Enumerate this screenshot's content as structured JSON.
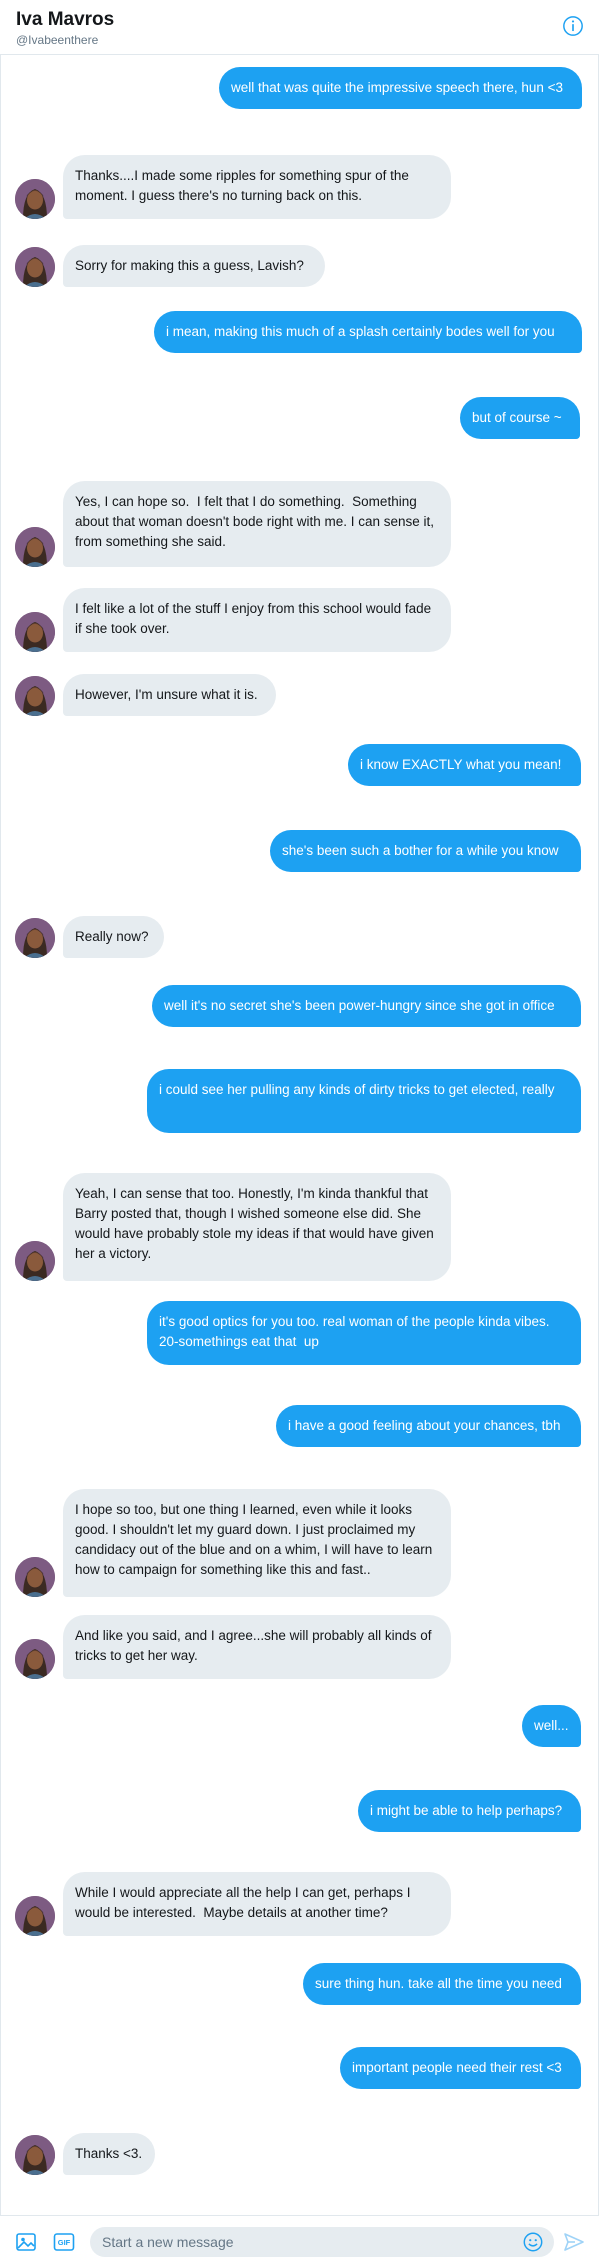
{
  "header": {
    "name": "Iva Mavros",
    "handle": "@Ivabeenthere"
  },
  "icons": {
    "info": "info-icon",
    "media": "image-icon",
    "gif": "gif-icon",
    "emoji": "emoji-icon",
    "send": "send-icon"
  },
  "colors": {
    "accent": "#1da1f2",
    "incoming_bubble": "#e6ecf0"
  },
  "gif_label": "GIF",
  "messages": [
    {
      "direction": "out",
      "text": "well that was quite the impressive speech there, hun <3"
    },
    {
      "direction": "in",
      "text": "Thanks....I made some ripples for something spur of the moment. I guess there's no turning back on this."
    },
    {
      "direction": "in",
      "text": "Sorry for making this a guess, Lavish?"
    },
    {
      "direction": "out",
      "text": "i mean, making this much of a splash certainly bodes well for you"
    },
    {
      "direction": "out",
      "text": "but of course ~"
    },
    {
      "direction": "in",
      "text": "Yes, I can hope so.  I felt that I do something.  Something about that woman doesn't bode right with me. I can sense it, from something she said."
    },
    {
      "direction": "in",
      "text": "I felt like a lot of the stuff I enjoy from this school would fade if she took over."
    },
    {
      "direction": "in",
      "text": "However, I'm unsure what it is."
    },
    {
      "direction": "out",
      "text": "i know EXACTLY what you mean!"
    },
    {
      "direction": "out",
      "text": "she's been such a bother for a while you know"
    },
    {
      "direction": "in",
      "text": "Really now?"
    },
    {
      "direction": "out",
      "text": "well it's no secret she's been power-hungry since she got in office"
    },
    {
      "direction": "out",
      "text": "i could see her pulling any kinds of dirty tricks to get elected, really"
    },
    {
      "direction": "in",
      "text": "Yeah, I can sense that too. Honestly, I'm kinda thankful that Barry posted that, though I wished someone else did. She would have probably stole my ideas if that would have given her a victory."
    },
    {
      "direction": "out",
      "text": "it's good optics for you too. real woman of the people kinda vibes. 20-somethings eat that  up"
    },
    {
      "direction": "out",
      "text": "i have a good feeling about your chances, tbh"
    },
    {
      "direction": "in",
      "text": "I hope so too, but one thing I learned, even while it looks good. I shouldn't let my guard down. I just proclaimed my candidacy out of the blue and on a whim, I will have to learn how to campaign for something like this and fast.."
    },
    {
      "direction": "in",
      "text": "And like you said, and I agree...she will probably all kinds of tricks to get her way."
    },
    {
      "direction": "out",
      "text": "well..."
    },
    {
      "direction": "out",
      "text": "i might be able to help perhaps?"
    },
    {
      "direction": "in",
      "text": "While I would appreciate all the help I can get, perhaps I would be interested.  Maybe details at another time?"
    },
    {
      "direction": "out",
      "text": "sure thing hun. take all the time you need"
    },
    {
      "direction": "out",
      "text": "important people need their rest <3"
    },
    {
      "direction": "in",
      "text": "Thanks <3."
    }
  ],
  "composer": {
    "placeholder": "Start a new message"
  }
}
